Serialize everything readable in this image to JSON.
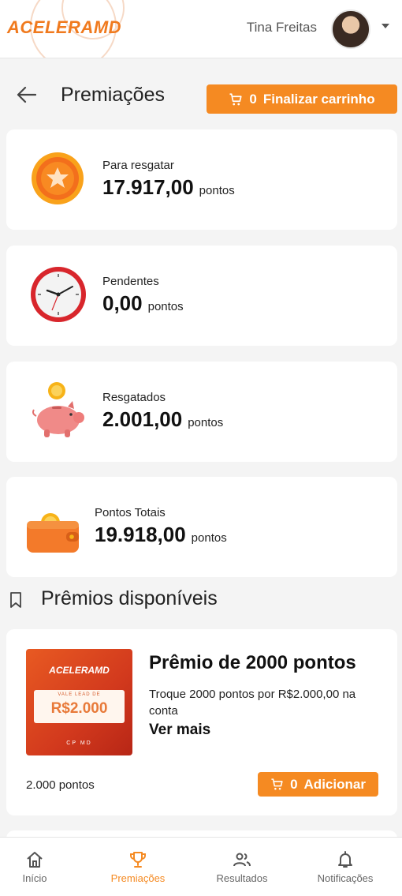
{
  "header": {
    "logo_text": "ACELERAMD",
    "user_name": "Tina Freitas"
  },
  "page": {
    "title": "Premiações",
    "cart_button": {
      "count": "0",
      "label": "Finalizar carrinho"
    }
  },
  "points": [
    {
      "label": "Para resgatar",
      "value": "17.917,00",
      "unit": "pontos",
      "icon": "medal-coin-icon"
    },
    {
      "label": "Pendentes",
      "value": "0,00",
      "unit": "pontos",
      "icon": "clock-icon"
    },
    {
      "label": "Resgatados",
      "value": "2.001,00",
      "unit": "pontos",
      "icon": "piggy-bank-icon"
    },
    {
      "label": "Pontos Totais",
      "value": "19.918,00",
      "unit": "pontos",
      "icon": "wallet-icon"
    }
  ],
  "section": {
    "title": "Prêmios disponíveis"
  },
  "prizes": [
    {
      "title": "Prêmio de 2000 pontos",
      "description": "Troque 2000 pontos por R$2.000,00 na conta",
      "more_label": "Ver mais",
      "points_label": "2.000 pontos",
      "add_button": {
        "count": "0",
        "label": "Adicionar"
      },
      "image": {
        "logo": "ACELERAMD",
        "ticket_label": "VALE LEAD DE",
        "ticket_value": "R$2.000",
        "footer": "CP  MD"
      }
    }
  ],
  "bottom_nav": [
    {
      "label": "Início",
      "icon": "home-icon",
      "active": false
    },
    {
      "label": "Premiações",
      "icon": "trophy-icon",
      "active": true
    },
    {
      "label": "Resultados",
      "icon": "people-icon",
      "active": false
    },
    {
      "label": "Notificações",
      "icon": "bell-icon",
      "active": false
    }
  ],
  "colors": {
    "accent": "#f58a22",
    "logo": "#f07a1e",
    "background": "#f4f4f4"
  }
}
